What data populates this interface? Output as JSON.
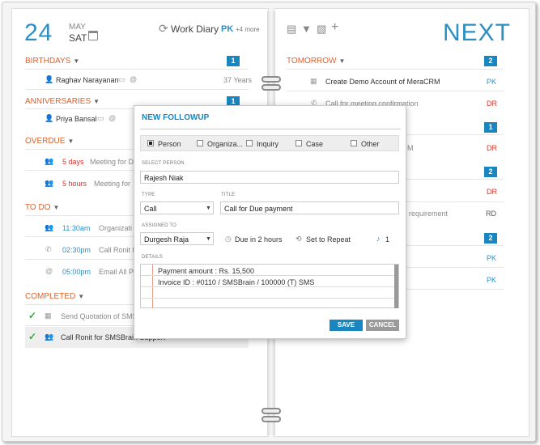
{
  "diary": {
    "date_day_num": "24",
    "date_month": "MAY",
    "date_weekday": "SAT",
    "title": "Work Diary",
    "user": "PK",
    "more": "+4 more",
    "next_label": "NEXT"
  },
  "left": {
    "birthdays": {
      "label": "BIRTHDAYS",
      "count": "1",
      "items": [
        {
          "name": "Raghav Narayanan",
          "meta": "37 Years"
        }
      ]
    },
    "anniversaries": {
      "label": "ANNIVERSARIES",
      "count": "1",
      "items": [
        {
          "name": "Priya Bansal"
        }
      ]
    },
    "overdue": {
      "label": "OVERDUE",
      "items": [
        {
          "time": "5 days",
          "text": "Meeting for D"
        },
        {
          "time": "5 hours",
          "text": "Meeting for"
        }
      ]
    },
    "todo": {
      "label": "TO DO",
      "items": [
        {
          "time": "11:30am",
          "text": "Organizati"
        },
        {
          "time": "02:30pm",
          "text": "Call Ronit fo"
        },
        {
          "time": "05:00pm",
          "text": "Email All Pr"
        }
      ]
    },
    "completed": {
      "label": "COMPLETED",
      "items": [
        {
          "text": "Send Quotation of SMS"
        },
        {
          "text": "Call Ronit for SMSBrain Support"
        }
      ]
    }
  },
  "right": {
    "tomorrow": {
      "label": "TOMORROW",
      "count": "2",
      "items": [
        {
          "text": "Create Demo Account of MeraCRM",
          "user": "PK"
        },
        {
          "text": "Call for meeting confirmation",
          "user": "DR"
        }
      ]
    },
    "sections": [
      {
        "count": "1",
        "items": [
          {
            "text": "M",
            "user": "DR"
          }
        ]
      },
      {
        "count": "2",
        "items": [
          {
            "text": "",
            "user": "DR"
          },
          {
            "text": "requirement",
            "user": "RD"
          }
        ]
      },
      {
        "count": "2",
        "items": [
          {
            "text": "",
            "user": "PK"
          },
          {
            "text": "",
            "user": "PK"
          }
        ]
      }
    ]
  },
  "modal": {
    "title": "NEW FOLLOWUP",
    "related_types": [
      "Person",
      "Organiza...",
      "Inquiry",
      "Case",
      "Other"
    ],
    "select_person_label": "SELECT PERSON",
    "select_person_value": "Rajesh Niak",
    "type_label": "TYPE",
    "type_value": "Call",
    "title_label": "TITLE",
    "title_value": "Call for Due payment",
    "assigned_label": "ASSIGNED TO",
    "assigned_value": "Durgesh Raja",
    "due_text": "Due in 2 hours",
    "repeat_text": "Set to Repeat",
    "reminder_count": "1",
    "details_label": "DETAILS",
    "details_lines": [
      "Payment amount : Rs. 15,500",
      "Invoice ID : #0110 / SMSBrain / 100000 (T) SMS"
    ],
    "save_label": "SAVE",
    "cancel_label": "CANCEL"
  },
  "colors": {
    "accent": "#1a86c0",
    "section": "#e0602a",
    "overdue": "#d9342b",
    "done": "#3aa63a",
    "cancel": "#9a9a9a"
  },
  "icons": [
    "calendar-icon",
    "refresh-icon",
    "person-icon",
    "card-icon",
    "at-icon",
    "phone-icon",
    "email-icon",
    "print-icon",
    "filter-icon",
    "export-icon",
    "add-icon",
    "checkmark-icon",
    "clock-icon",
    "repeat-icon",
    "bell-icon"
  ]
}
